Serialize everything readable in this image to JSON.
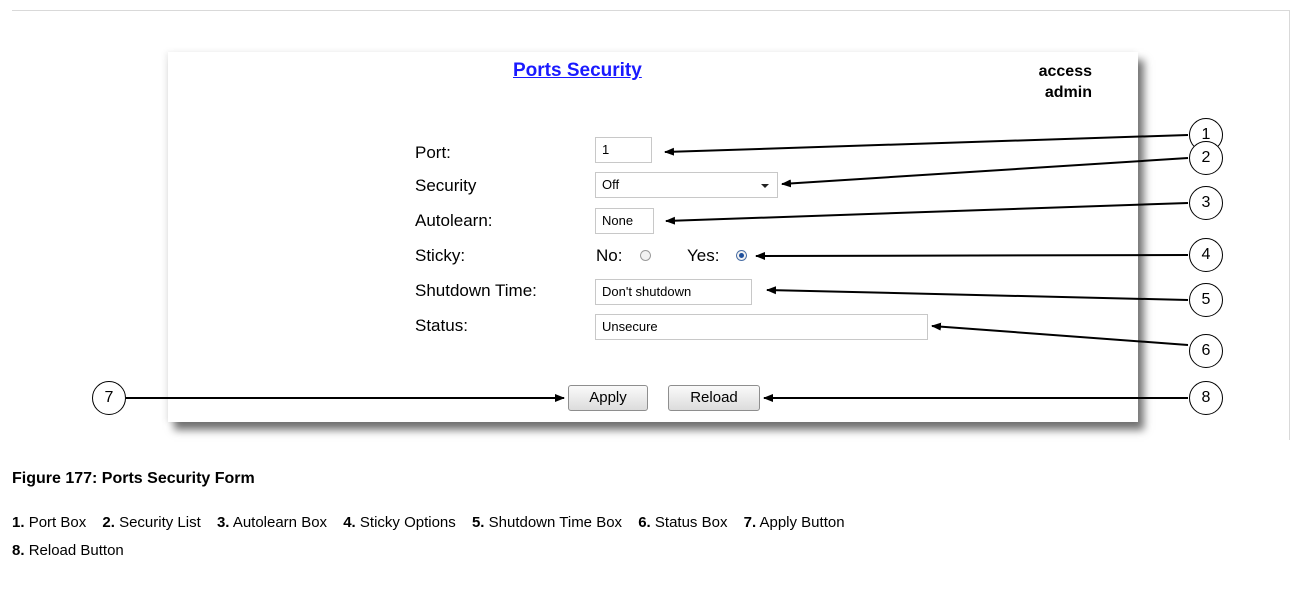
{
  "form": {
    "title": "Ports Security",
    "access_line1": "access",
    "access_line2": "admin",
    "fields": {
      "port": {
        "label": "Port:",
        "value": "1"
      },
      "security": {
        "label": "Security",
        "value": "Off"
      },
      "autolearn": {
        "label": "Autolearn:",
        "value": "None"
      },
      "sticky": {
        "label": "Sticky:",
        "no_label": "No:",
        "yes_label": "Yes:",
        "selected": "Yes"
      },
      "shutdown_time": {
        "label": "Shutdown Time:",
        "value": "Don't shutdown"
      },
      "status": {
        "label": "Status:",
        "value": "Unsecure"
      }
    },
    "buttons": {
      "apply": "Apply",
      "reload": "Reload"
    }
  },
  "callouts": [
    "1",
    "2",
    "3",
    "4",
    "5",
    "6",
    "7",
    "8"
  ],
  "caption": "Figure 177: Ports Security Form",
  "legend": [
    {
      "num": "1.",
      "text": "Port Box"
    },
    {
      "num": "2.",
      "text": "Security List"
    },
    {
      "num": "3.",
      "text": "Autolearn Box"
    },
    {
      "num": "4.",
      "text": "Sticky Options"
    },
    {
      "num": "5.",
      "text": "Shutdown Time Box"
    },
    {
      "num": "6.",
      "text": "Status Box"
    },
    {
      "num": "7.",
      "text": "Apply Button"
    },
    {
      "num": "8.",
      "text": "Reload Button"
    }
  ]
}
